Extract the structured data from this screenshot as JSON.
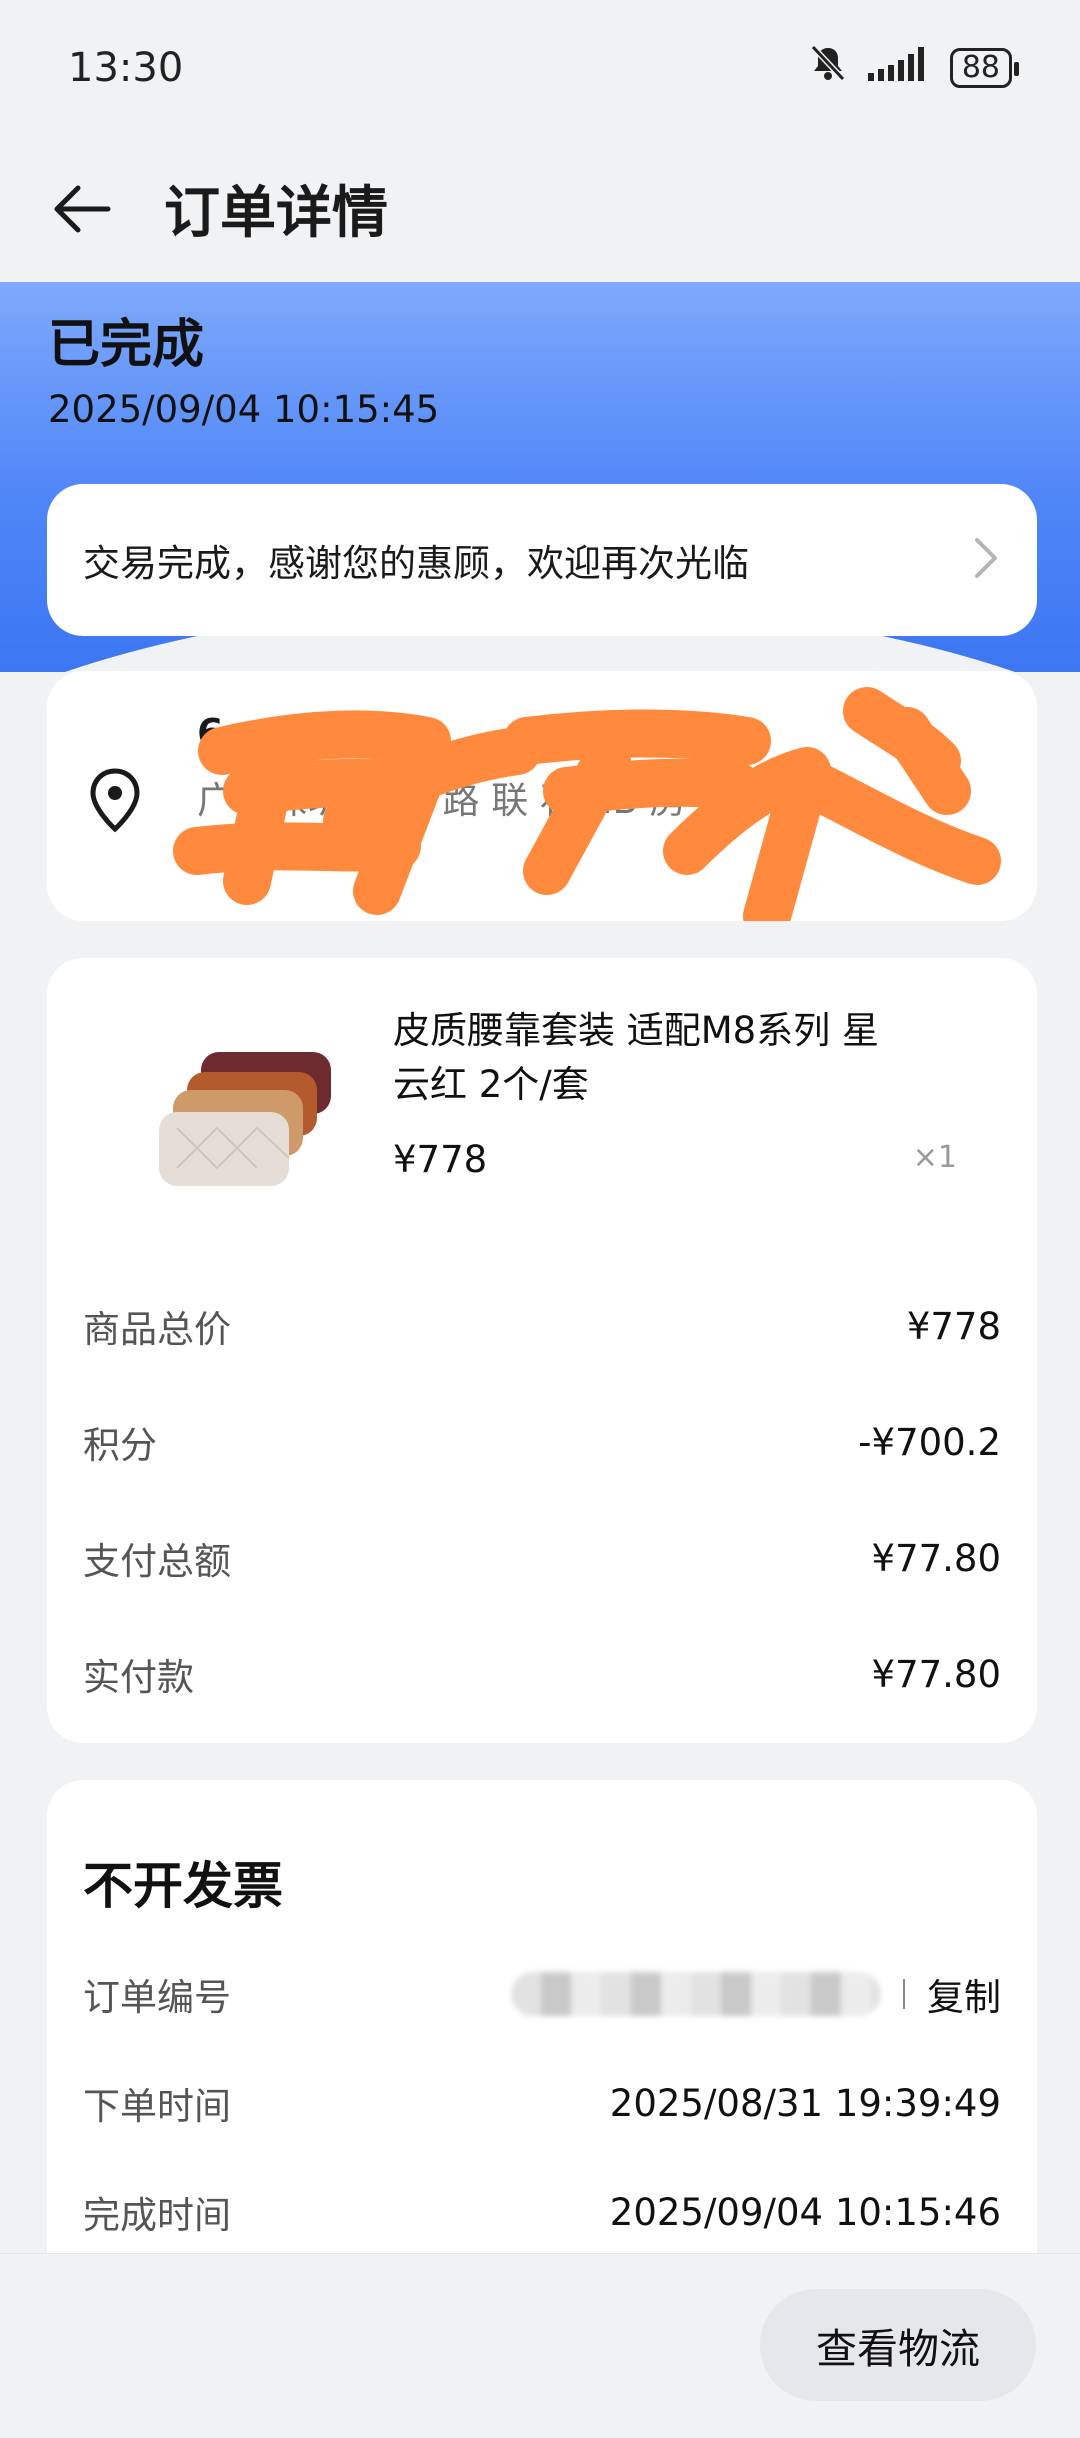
{
  "status_bar": {
    "time": "13:30",
    "battery": "88"
  },
  "header": {
    "title": "订单详情"
  },
  "order_status": {
    "title": "已完成",
    "time": "2025/09/04 10:15:45"
  },
  "notice": {
    "text": "交易完成，感谢您的惠顾，欢迎再次光临"
  },
  "address": {
    "line1": "6 . 2",
    "line2": "广东深圳宝 新 路 联 石 1B 房"
  },
  "product": {
    "name": "皮质腰靠套装 适配M8系列 星云红 2个/套",
    "price": "¥778",
    "quantity": "×1"
  },
  "price_rows": [
    {
      "label": "商品总价",
      "value": "¥778"
    },
    {
      "label": "积分",
      "value": "-¥700.2"
    },
    {
      "label": "支付总额",
      "value": "¥77.80"
    },
    {
      "label": "实付款",
      "value": "¥77.80"
    }
  ],
  "invoice": {
    "title": "不开发票",
    "order_no_label": "订单编号",
    "copy_label": "复制",
    "order_time_label": "下单时间",
    "order_time": "2025/08/31 19:39:49",
    "complete_time_label": "完成时间",
    "complete_time": "2025/09/04 10:15:46"
  },
  "footer": {
    "logistics_button": "查看物流"
  },
  "colors": {
    "hero_blue": "#4f86f7",
    "redaction_orange": "#ff8a3d",
    "background": "#f1f2f4"
  }
}
